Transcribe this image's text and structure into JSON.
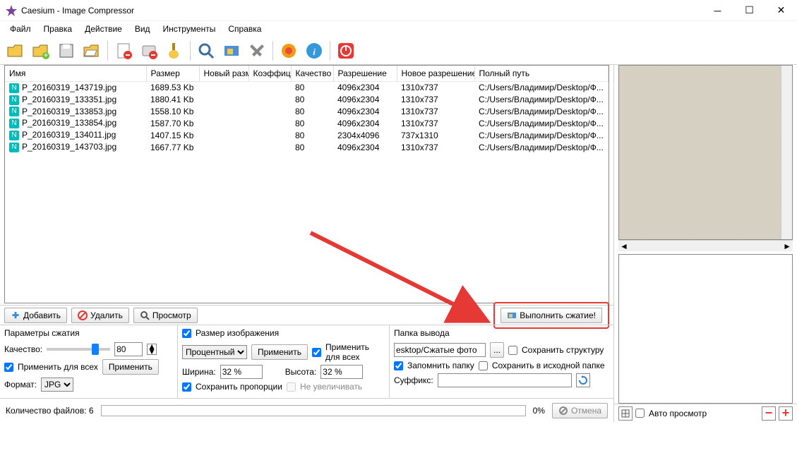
{
  "window": {
    "title": "Caesium - Image Compressor"
  },
  "menu": [
    "Файл",
    "Правка",
    "Действие",
    "Вид",
    "Инструменты",
    "Справка"
  ],
  "columns": {
    "name": "Имя",
    "size": "Размер",
    "newsize": "Новый разм",
    "ratio": "Коэффици",
    "quality": "Качество",
    "res": "Разрешение",
    "newres": "Новое разрешение",
    "path": "Полный путь"
  },
  "rows": [
    {
      "name": "P_20160319_143719.jpg",
      "size": "1689.53 Kb",
      "q": "80",
      "res": "4096x2304",
      "newres": "1310x737",
      "path": "C:/Users/Владимир/Desktop/Ф..."
    },
    {
      "name": "P_20160319_133351.jpg",
      "size": "1880.41 Kb",
      "q": "80",
      "res": "4096x2304",
      "newres": "1310x737",
      "path": "C:/Users/Владимир/Desktop/Ф..."
    },
    {
      "name": "P_20160319_133853.jpg",
      "size": "1558.10 Kb",
      "q": "80",
      "res": "4096x2304",
      "newres": "1310x737",
      "path": "C:/Users/Владимир/Desktop/Ф..."
    },
    {
      "name": "P_20160319_133854.jpg",
      "size": "1587.70 Kb",
      "q": "80",
      "res": "4096x2304",
      "newres": "1310x737",
      "path": "C:/Users/Владимир/Desktop/Ф..."
    },
    {
      "name": "P_20160319_134011.jpg",
      "size": "1407.15 Kb",
      "q": "80",
      "res": "2304x4096",
      "newres": "737x1310",
      "path": "C:/Users/Владимир/Desktop/Ф..."
    },
    {
      "name": "P_20160319_143703.jpg",
      "size": "1667.77 Kb",
      "q": "80",
      "res": "4096x2304",
      "newres": "1310x737",
      "path": "C:/Users/Владимир/Desktop/Ф..."
    }
  ],
  "listbuttons": {
    "add": "Добавить",
    "remove": "Удалить",
    "preview": "Просмотр",
    "compress": "Выполнить сжатие!"
  },
  "compression": {
    "title": "Параметры сжатия",
    "quality_label": "Качество:",
    "quality_value": "80",
    "apply_all": "Применить для всех",
    "apply": "Применить",
    "format_label": "Формат:",
    "format_value": "JPG"
  },
  "imagesize": {
    "title": "Размер изображения",
    "mode": "Процентный",
    "apply": "Применить",
    "apply_all": "Применить для всех",
    "width_label": "Ширина:",
    "width_val": "32 %",
    "height_label": "Высота:",
    "height_val": "32 %",
    "keep_ratio": "Сохранить пропорции",
    "no_upscale": "Не увеличивать",
    "checked_title": true
  },
  "output": {
    "title": "Папка вывода",
    "folder": "esktop/Сжатые фото",
    "browse": "...",
    "keep_structure": "Сохранить структуру",
    "remember": "Запомнить папку",
    "save_source": "Сохранить в исходной папке",
    "suffix_label": "Суффикс:",
    "suffix_val": ""
  },
  "status": {
    "filecount": "Количество файлов: 6",
    "progress": "0%",
    "cancel": "Отмена"
  },
  "preview": {
    "auto": "Авто просмотр"
  }
}
